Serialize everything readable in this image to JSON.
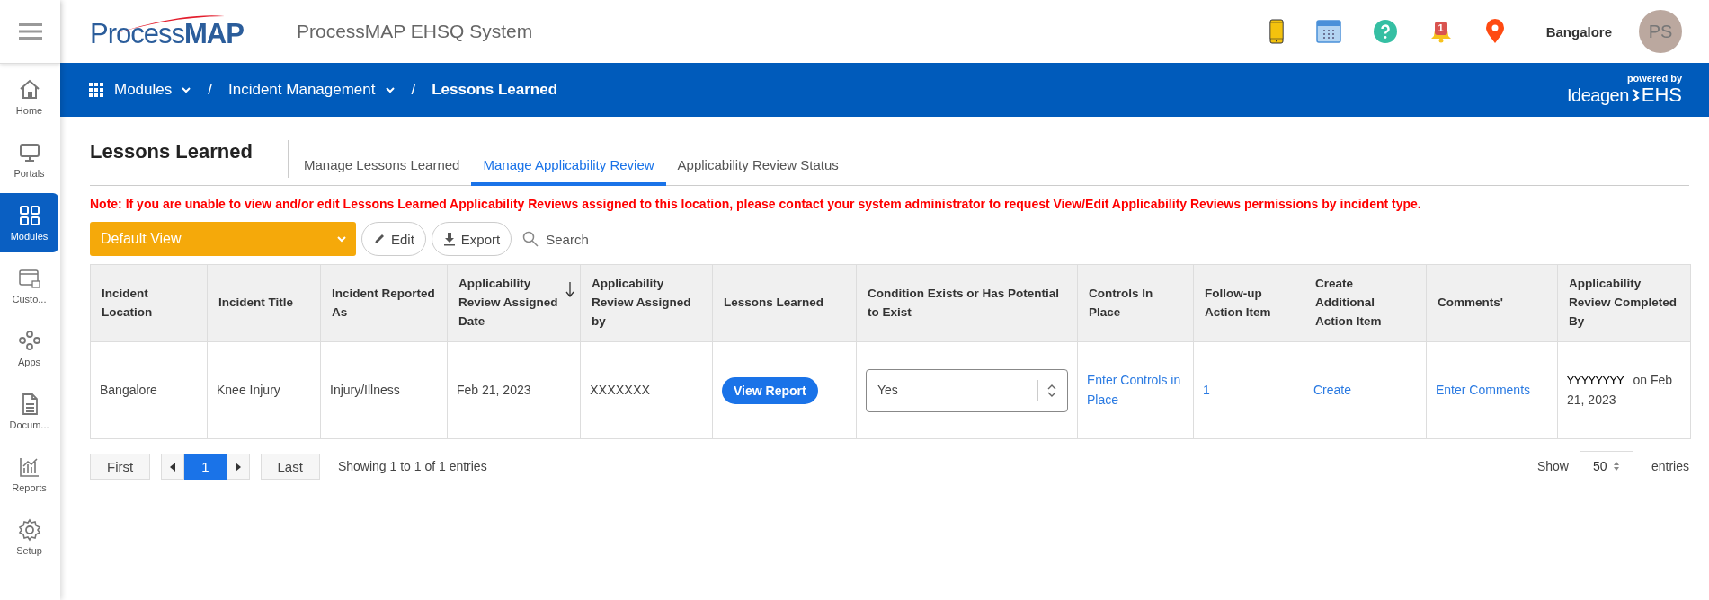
{
  "header": {
    "logo": "Process**MAP**",
    "app_title": "ProcessMAP EHSQ System",
    "notification_count": "1",
    "location": "Bangalore",
    "avatar_initials": "PS"
  },
  "sidebar": {
    "items": [
      {
        "label": "Home",
        "selected": false
      },
      {
        "label": "Portals",
        "selected": false
      },
      {
        "label": "Modules",
        "selected": true
      },
      {
        "label": "Custo...",
        "selected": false
      },
      {
        "label": "Apps",
        "selected": false
      },
      {
        "label": "Docum...",
        "selected": false
      },
      {
        "label": "Reports",
        "selected": false
      },
      {
        "label": "Setup",
        "selected": false
      }
    ]
  },
  "breadcrumb": [
    {
      "label": "Modules",
      "dropdown": true
    },
    {
      "separator": "/",
      "label": "Incident Management",
      "dropdown": true
    },
    {
      "separator": "/",
      "label": "Lessons Learned",
      "dropdown": false
    }
  ],
  "branding": {
    "powered_by": "powered by",
    "brand": "Ideagen",
    "product": "EHS"
  },
  "page_title": "Lessons Learned",
  "tabs": [
    {
      "label": "Manage Lessons Learned",
      "selected": false
    },
    {
      "label": "Manage Applicability Review",
      "selected": true
    },
    {
      "label": "Applicability Review Status",
      "selected": false
    }
  ],
  "note": "Note: If you are unable to view and/or edit Lessons Learned Applicability Reviews assigned to this location, please contact your system administrator to request View/Edit Applicability Reviews permissions by incident type.",
  "toolbar": {
    "view": "Default View",
    "edit": "Edit",
    "export": "Export",
    "search": "Search"
  },
  "table": {
    "columns": [
      {
        "label": "Incident Location",
        "sorted": false
      },
      {
        "label": "Incident Title",
        "sorted": false
      },
      {
        "label": "Incident Reported As",
        "sorted": false
      },
      {
        "label": "Applicability Review Assigned Date",
        "sorted": true
      },
      {
        "label": "Applicability Review Assigned by",
        "sorted": false
      },
      {
        "label": "Lessons Learned",
        "sorted": false
      },
      {
        "label": "Condition Exists or Has Potential to Exist",
        "sorted": false
      },
      {
        "label": "Controls In Place",
        "sorted": false
      },
      {
        "label": "Follow-up Action Item",
        "sorted": false
      },
      {
        "label": "Create Additional Action Item",
        "sorted": false
      },
      {
        "label": "Comments'",
        "sorted": false
      },
      {
        "label": "Applicability Review Completed By",
        "sorted": false
      }
    ],
    "rows": [
      {
        "cells": [
          {
            "kind": "text",
            "text": "Bangalore"
          },
          {
            "kind": "text",
            "text": "Knee Injury"
          },
          {
            "kind": "text",
            "text": "Injury/Illness"
          },
          {
            "kind": "text",
            "text": "Feb 21, 2023"
          },
          {
            "kind": "user",
            "text": "XXXXXXX"
          },
          {
            "kind": "button",
            "text": "View Report"
          },
          {
            "kind": "select",
            "text": "Yes"
          },
          {
            "kind": "link",
            "text": "Enter Controls in Place"
          },
          {
            "kind": "link",
            "text": "1"
          },
          {
            "kind": "link",
            "text": "Create"
          },
          {
            "kind": "link",
            "text": "Enter Comments"
          },
          {
            "kind": "completed",
            "user": "YYYYYYYY",
            "text": "on Feb 21, 2023"
          }
        ]
      }
    ]
  },
  "pagination": {
    "first": "First",
    "pages": [
      {
        "label": "1",
        "selected": true
      }
    ],
    "last": "Last",
    "info": "Showing 1 to 1 of 1 entries",
    "show": "Show",
    "page_size": "50",
    "entries": "entries"
  }
}
